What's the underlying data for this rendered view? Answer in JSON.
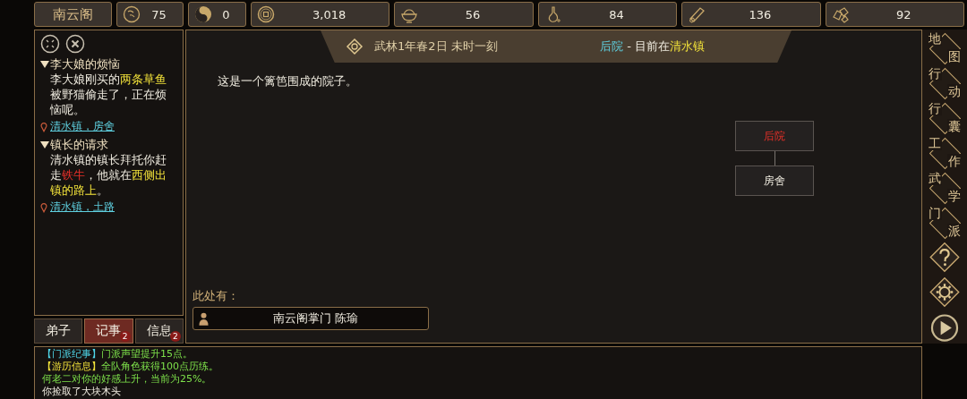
{
  "top_bar": {
    "sect_name": "南云阁",
    "stats": [
      {
        "value": "75"
      },
      {
        "value": "0"
      },
      {
        "value": "3,018"
      },
      {
        "value": "56"
      },
      {
        "value": "84"
      },
      {
        "value": "136"
      },
      {
        "value": "92"
      }
    ]
  },
  "quests": [
    {
      "title": "李大娘的烦恼",
      "expanded": true,
      "segments": [
        {
          "kind": "plain",
          "text": "李大娘刚买的"
        },
        {
          "kind": "highlight",
          "text": "两条草鱼"
        },
        {
          "kind": "plain",
          "text": "被野猫偷走了，正在烦恼呢。"
        }
      ],
      "location": "清水镇，房舍"
    },
    {
      "title": "镇长的请求",
      "expanded": true,
      "segments": [
        {
          "kind": "plain",
          "text": "清水镇的镇长拜托你赶走"
        },
        {
          "kind": "danger",
          "text": "铁牛"
        },
        {
          "kind": "plain",
          "text": "，他就在"
        },
        {
          "kind": "highlight",
          "text": "西侧出镇的路上"
        },
        {
          "kind": "plain",
          "text": "。"
        }
      ],
      "location": "清水镇，土路"
    }
  ],
  "tabs": [
    {
      "label": "弟子",
      "selected": false
    },
    {
      "label": "记事",
      "selected": true,
      "badge": "2"
    },
    {
      "label": "信息",
      "selected": false,
      "badge": "2"
    }
  ],
  "header": {
    "date": "武林1年春2日 未时一刻",
    "place": "后院",
    "separator": "-",
    "location_prefix": "目前在",
    "town": "清水镇"
  },
  "description": "这是一个篱笆围成的院子。",
  "map": [
    {
      "label": "后院",
      "selected": true
    },
    {
      "label": "房舍",
      "selected": false
    }
  ],
  "present_label": "此处有：",
  "characters": [
    {
      "name": "南云阁掌门 陈瑜"
    }
  ],
  "side_menu": [
    {
      "kind": "text",
      "label": "地图"
    },
    {
      "kind": "text",
      "label": "行动"
    },
    {
      "kind": "text",
      "label": "行囊"
    },
    {
      "kind": "text",
      "label": "工作"
    },
    {
      "kind": "text",
      "label": "武学"
    },
    {
      "kind": "text",
      "label": "门派"
    },
    {
      "kind": "help"
    },
    {
      "kind": "settings"
    }
  ],
  "log": [
    {
      "segments": [
        {
          "kind": "tag-cyan",
          "text": "【门派纪事】"
        },
        {
          "kind": "green",
          "text": "门派声望提升15点。"
        }
      ]
    },
    {
      "segments": [
        {
          "kind": "tag-yellow",
          "text": "【游历信息】"
        },
        {
          "kind": "green",
          "text": "全队角色获得100点历练。"
        }
      ]
    },
    {
      "segments": [
        {
          "kind": "green",
          "text": "何老二对你的好感上升，当前为25%。"
        }
      ]
    },
    {
      "segments": [
        {
          "kind": "white",
          "text": "你捡取了大块木头"
        }
      ]
    }
  ]
}
